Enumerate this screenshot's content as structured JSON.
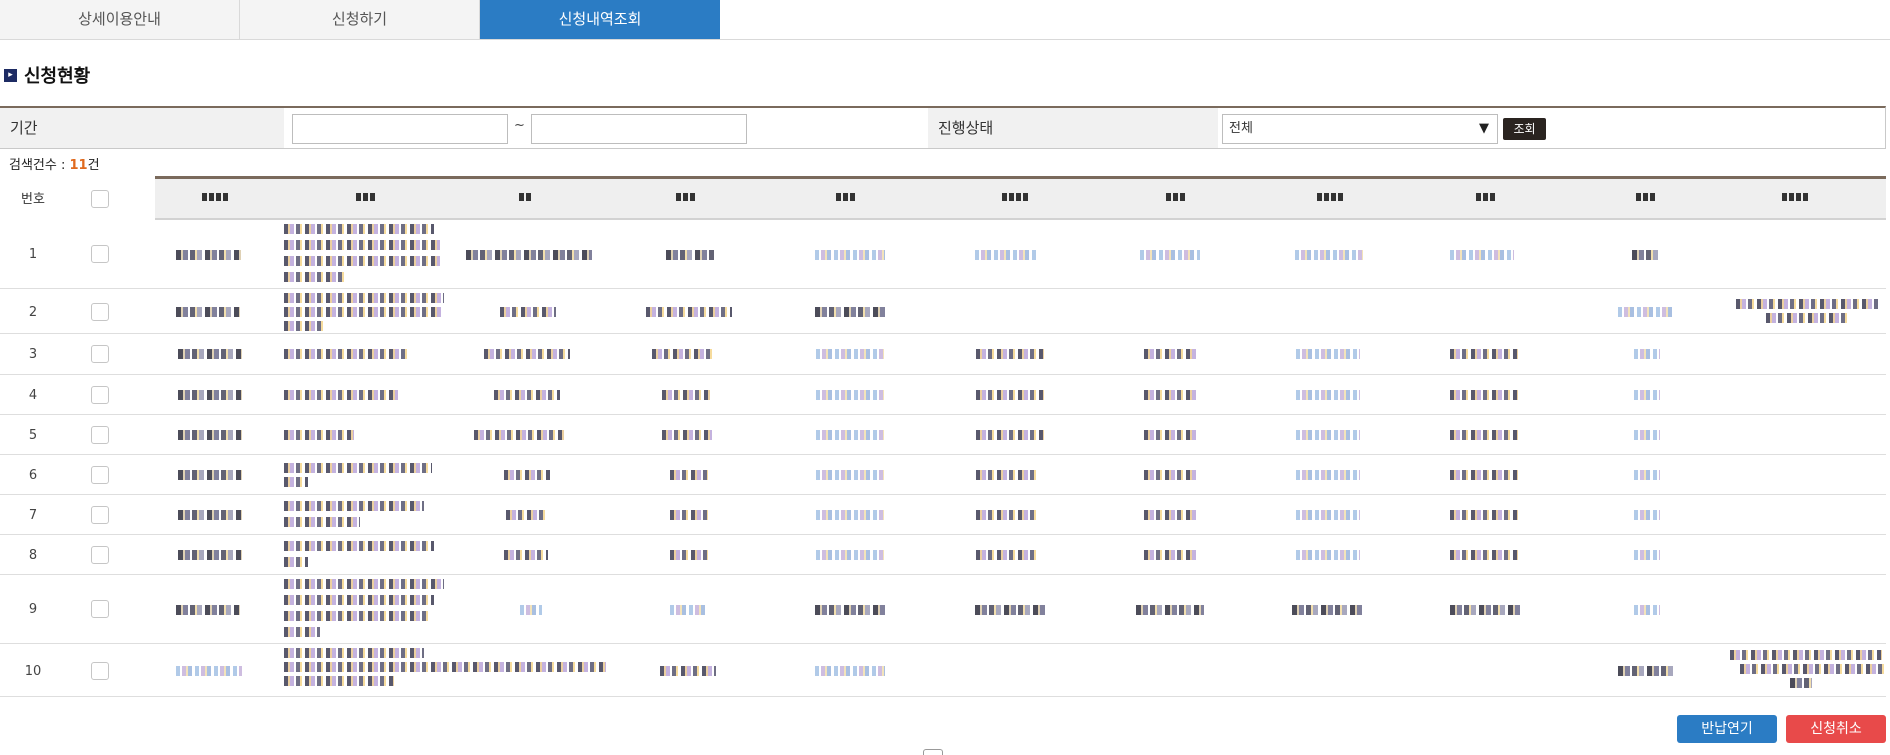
{
  "tabs": [
    {
      "label": "상세이용안내",
      "active": false
    },
    {
      "label": "신청하기",
      "active": false
    },
    {
      "label": "신청내역조회",
      "active": true
    }
  ],
  "section": {
    "title": "신청현황",
    "marker_icon": "chevron-right-icon"
  },
  "filter": {
    "period_label": "기간",
    "date_from": "",
    "date_to": "",
    "range_separator": "~",
    "status_label": "진행상태",
    "status_selected": "전체",
    "search_button": "조회"
  },
  "result": {
    "label": "검색건수 : ",
    "count": "11",
    "suffix": "건"
  },
  "table": {
    "header_no": "번호",
    "rows": [
      {
        "no": "1"
      },
      {
        "no": "2"
      },
      {
        "no": "3"
      },
      {
        "no": "4"
      },
      {
        "no": "5"
      },
      {
        "no": "6"
      },
      {
        "no": "7"
      },
      {
        "no": "8"
      },
      {
        "no": "9"
      },
      {
        "no": "10"
      }
    ]
  },
  "buttons": {
    "extend": "반납연기",
    "cancel": "신청취소"
  },
  "colors": {
    "accent_blue": "#2b7cc4",
    "cancel_red": "#e84a4a",
    "count_orange": "#e06a1e",
    "header_rule": "#7a6a5c"
  }
}
